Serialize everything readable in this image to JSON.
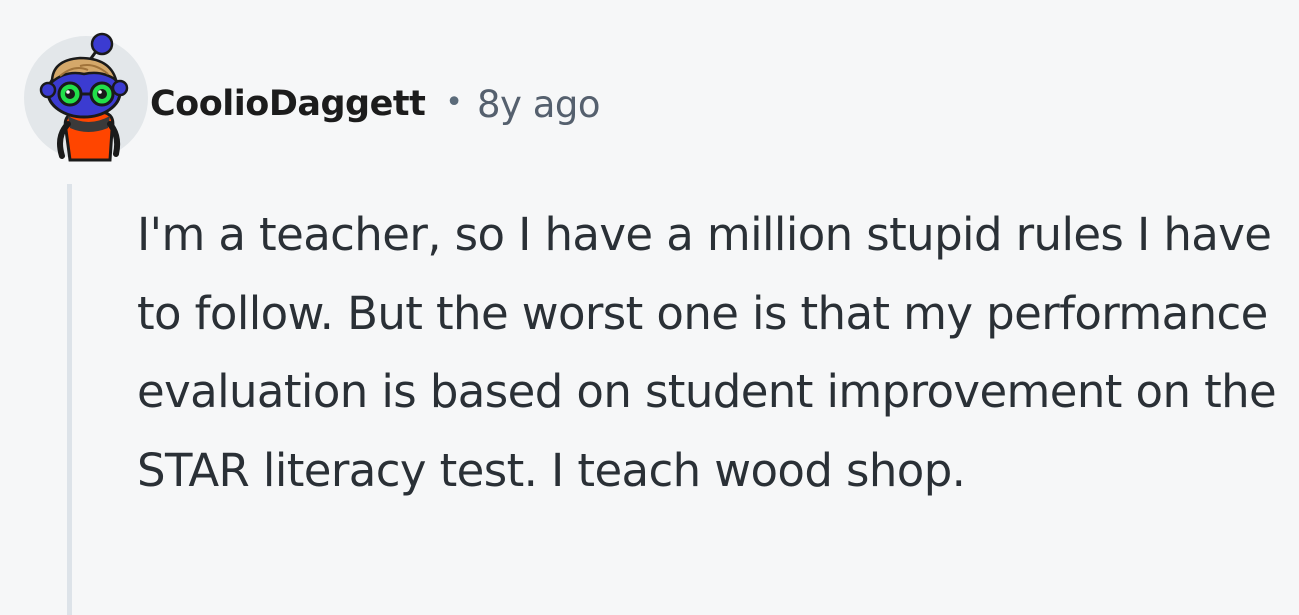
{
  "comment": {
    "author": "CoolioDaggett",
    "separator": "•",
    "timestamp": "8y ago",
    "body": "I'm a teacher, so I have a million stupid rules I have to follow. But the worst one is that my performance evaluation is based on student improvement on the STAR literacy test. I teach wood shop."
  },
  "avatar": {
    "icon": "snoo-avatar-icon",
    "colors": {
      "background": "#e3e7ea",
      "body": "#ff4500",
      "head": "#3b3bd1",
      "hair": "#d4a86a",
      "glasses": "#22e04a"
    }
  },
  "colors": {
    "page_background": "#f6f7f8",
    "username": "#1c1c1c",
    "meta": "#55606e",
    "body_text": "#2a3036",
    "thread_line": "#dde3e9"
  }
}
